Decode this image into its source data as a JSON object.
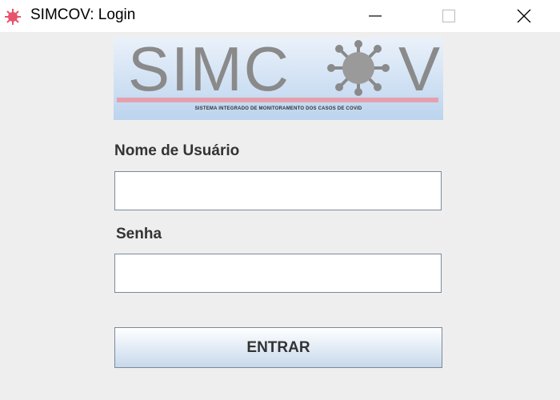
{
  "window": {
    "title": "SIMCOV: Login",
    "minimize_icon": "minimize-icon",
    "maximize_icon": "maximize-icon",
    "close_icon": "close-icon"
  },
  "logo": {
    "text": "SIMC",
    "text_end": "V",
    "subtitle": "SISTEMA INTEGRADO DE MONITORAMENTO DOS CASOS DE COVID"
  },
  "form": {
    "username_label": "Nome de Usuário",
    "username_value": "",
    "password_label": "Senha",
    "password_value": "",
    "submit_label": "ENTRAR"
  },
  "colors": {
    "accent": "#e8536c",
    "logo_bar": "#e5a0ae"
  }
}
